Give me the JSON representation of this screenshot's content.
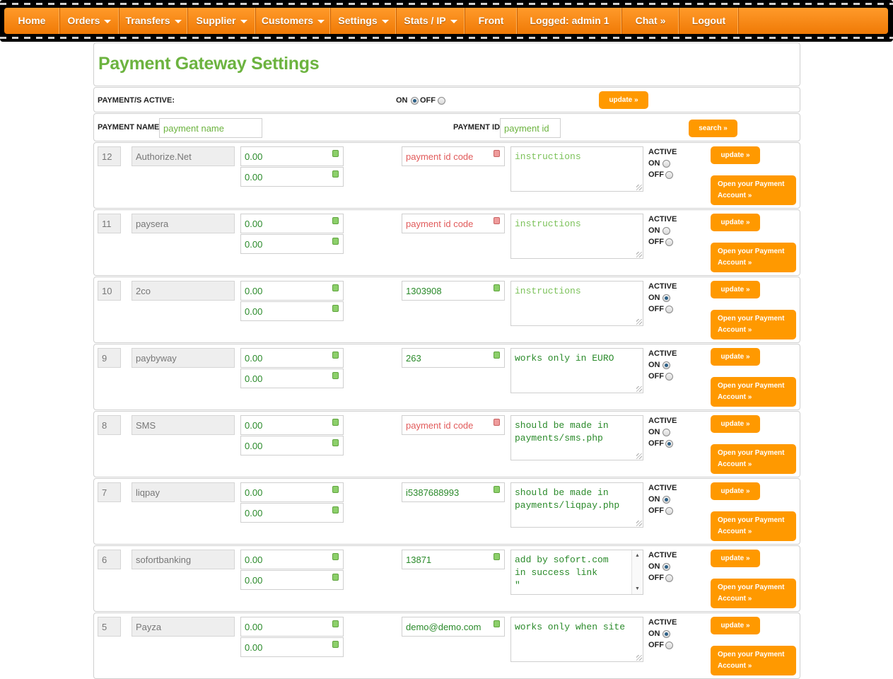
{
  "nav": [
    {
      "label": "Home",
      "dropdown": false
    },
    {
      "label": "Orders",
      "dropdown": true
    },
    {
      "label": "Transfers",
      "dropdown": true
    },
    {
      "label": "Supplier",
      "dropdown": true
    },
    {
      "label": "Customers",
      "dropdown": true
    },
    {
      "label": "Settings",
      "dropdown": true
    },
    {
      "label": "Stats / IP",
      "dropdown": true
    },
    {
      "label": "Front",
      "dropdown": false
    },
    {
      "label": "Logged: admin 1",
      "dropdown": false
    },
    {
      "label": "Chat »",
      "dropdown": false
    },
    {
      "label": "Logout",
      "dropdown": false
    }
  ],
  "page_title": "Payment Gateway Settings",
  "active_bar": {
    "label": "PAYMENT/S ACTIVE:",
    "on_label": "ON",
    "off_label": "OFF",
    "selected": "on",
    "update_label": "update »"
  },
  "search_bar": {
    "name_label": "PAYMENT NAME",
    "name_placeholder": "payment name",
    "id_label": "PAYMENT ID",
    "id_placeholder": "payment id",
    "search_label": "search »"
  },
  "row_labels": {
    "active": "ACTIVE",
    "on": "ON",
    "off": "OFF",
    "update": "update »",
    "open_line1": "Open your Payment",
    "open_line2": "Account »",
    "code_placeholder": "payment id code",
    "instructions_placeholder": "instructions"
  },
  "payments": [
    {
      "id": "12",
      "name": "Authorize.Net",
      "fee1": "0.00",
      "fee2": "0.00",
      "code": "",
      "instructions": "",
      "active": "none"
    },
    {
      "id": "11",
      "name": "paysera",
      "fee1": "0.00",
      "fee2": "0.00",
      "code": "",
      "instructions": "",
      "active": "none"
    },
    {
      "id": "10",
      "name": "2co",
      "fee1": "0.00",
      "fee2": "0.00",
      "code": "1303908",
      "instructions": "",
      "active": "on"
    },
    {
      "id": "9",
      "name": "paybyway",
      "fee1": "0.00",
      "fee2": "0.00",
      "code": "263",
      "instructions": "works only in EURO",
      "active": "on"
    },
    {
      "id": "8",
      "name": "SMS",
      "fee1": "0.00",
      "fee2": "0.00",
      "code": "",
      "instructions": "should be made in\npayments/sms.php",
      "active": "off"
    },
    {
      "id": "7",
      "name": "liqpay",
      "fee1": "0.00",
      "fee2": "0.00",
      "code": "i5387688993",
      "instructions": "should be made in\npayments/liqpay.php",
      "active": "on"
    },
    {
      "id": "6",
      "name": "sofortbanking",
      "fee1": "0.00",
      "fee2": "0.00",
      "code": "13871",
      "instructions": "add by sofort.com\nin success link\n\"",
      "active": "on",
      "scroll": true
    },
    {
      "id": "5",
      "name": "Payza",
      "fee1": "0.00",
      "fee2": "0.00",
      "code": "demo@demo.com",
      "instructions": "works only when site",
      "active": "on"
    }
  ]
}
